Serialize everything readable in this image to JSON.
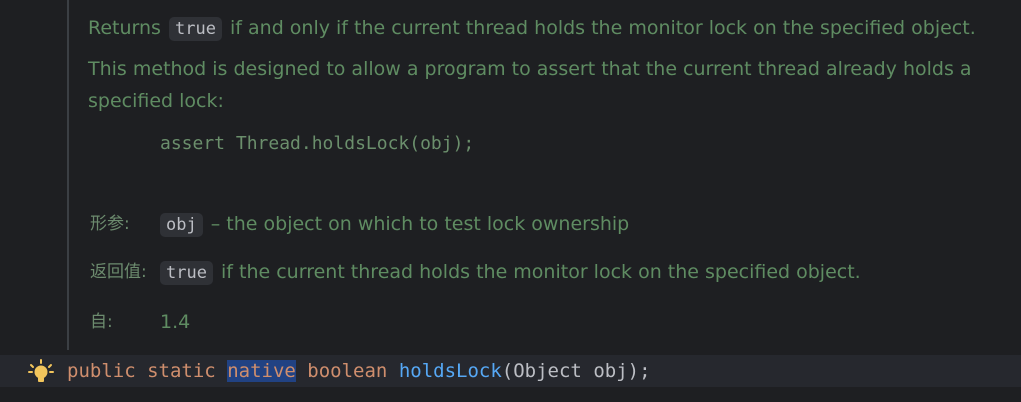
{
  "doc": {
    "line1": {
      "prefix": "Returns",
      "chip": "true",
      "suffix": "if and only if the current thread holds the monitor lock on the specified object."
    },
    "line2": "This method is designed to allow a program to assert that the current thread already holds a",
    "line3": "specified lock:",
    "example": "assert Thread.holdsLock(obj);",
    "params": {
      "label": "形参:",
      "chip": "obj",
      "text": "– the object on which to test lock ownership"
    },
    "returns": {
      "label": "返回值:",
      "chip": "true",
      "text": "if the current thread holds the monitor lock on the specified object."
    },
    "since": {
      "label": "自:",
      "value": "1.4"
    }
  },
  "code": {
    "kw_public": "public",
    "kw_static": "static",
    "kw_native": "native",
    "kw_boolean": "boolean",
    "method": "holdsLock",
    "open": "(",
    "param_type": "Object",
    "param_name": "obj",
    "close": ");"
  },
  "icons": {
    "bulb": "lightbulb-icon"
  },
  "colors": {
    "background": "#1e1f22",
    "doc_text": "#5f8c62",
    "keyword": "#cf8e6d",
    "method": "#56a8f5",
    "selection": "#214283",
    "bulb": "#f2c55c"
  }
}
